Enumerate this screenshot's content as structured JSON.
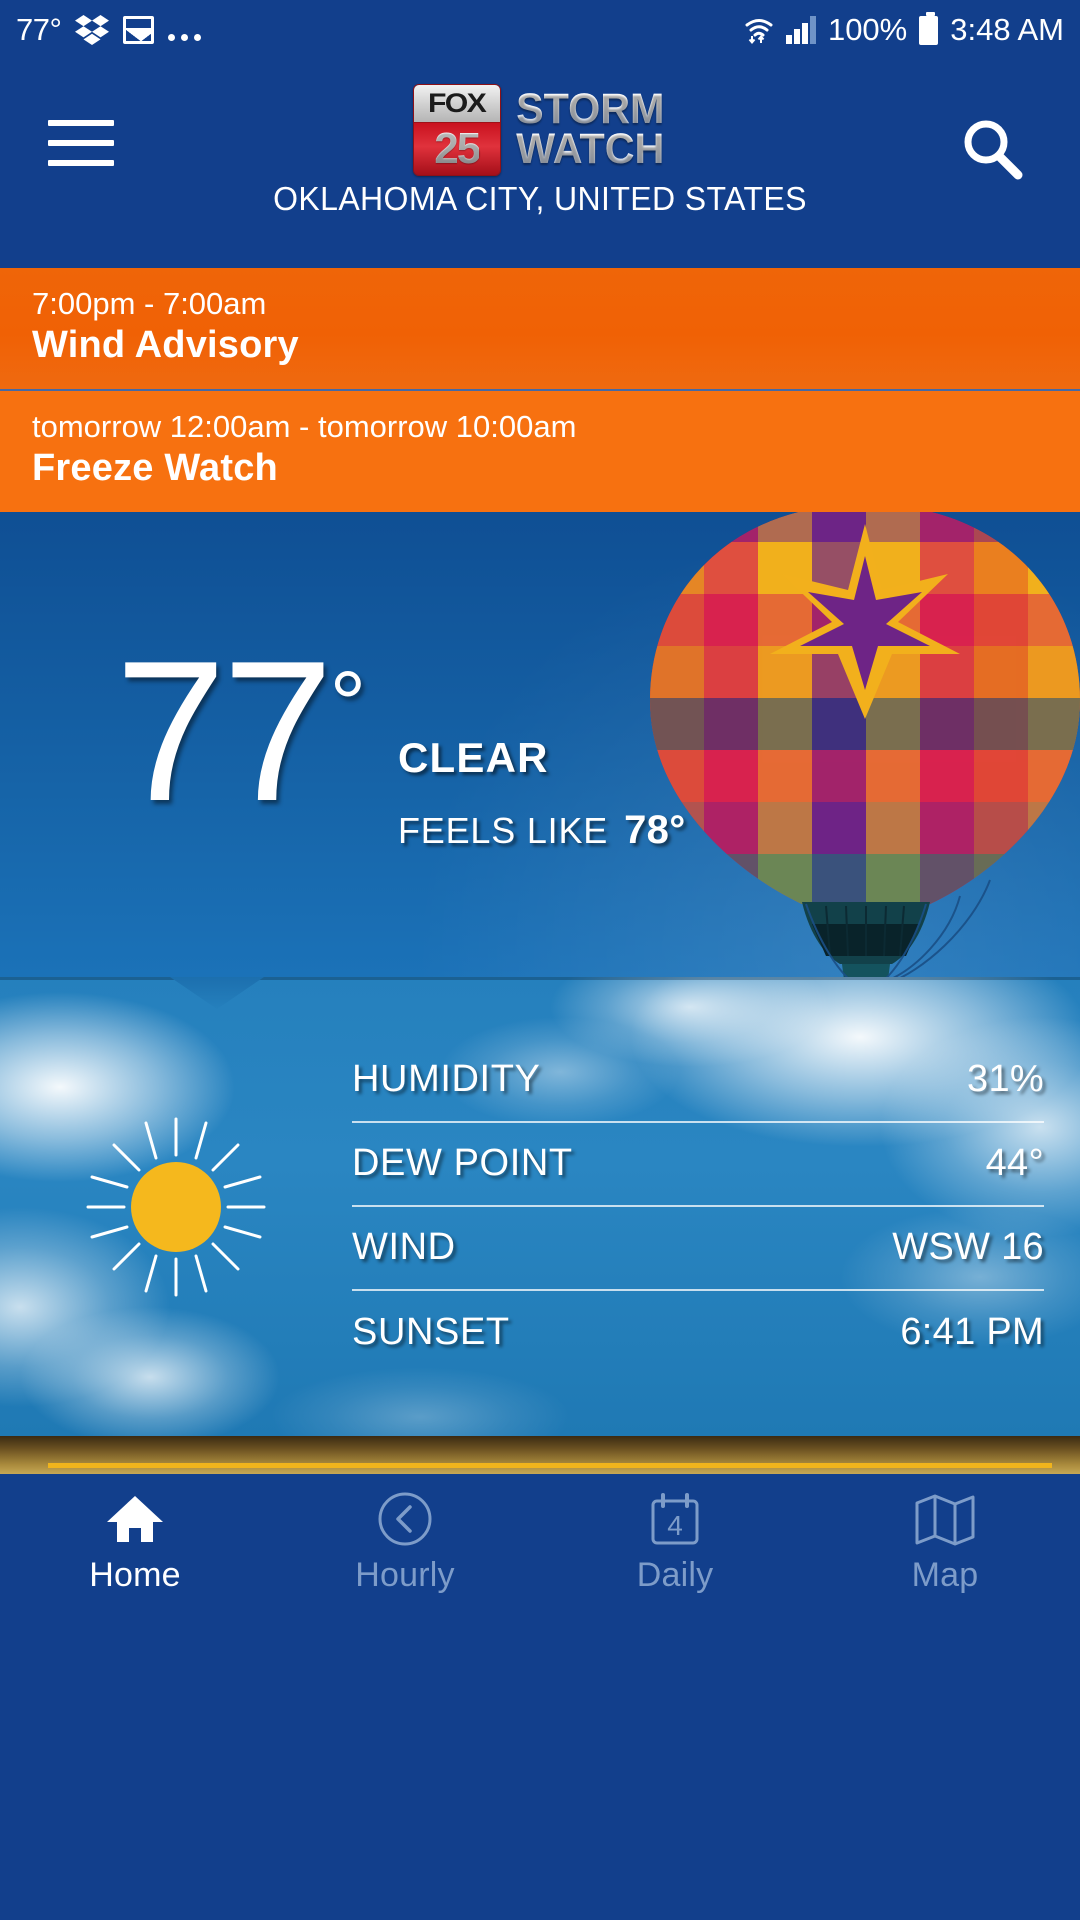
{
  "colors": {
    "brand_blue": "#123F8C",
    "alert_orange": "#F06105",
    "alert_orange_2": "#F77110",
    "sky_blue": "#1B72B8",
    "panel_blue": "#2580BD",
    "sun_gold": "#F5B81D",
    "nav_inactive": "#7D9CC9",
    "accent_yellow": "#F0B41C"
  },
  "statusbar": {
    "temp": "77°",
    "icons": [
      "dropbox-icon",
      "gallery-icon",
      "ellipsis-icon"
    ],
    "wifi_icon": "wifi-icon",
    "signal_icon": "cellular-signal-icon",
    "battery_percent": "100%",
    "battery_icon": "battery-full-icon",
    "clock": "3:48 AM"
  },
  "header": {
    "menu_icon": "hamburger-menu-icon",
    "search_icon": "search-icon",
    "logo": {
      "channel": "FOX",
      "number": "25",
      "line1": "STORM",
      "line2": "WATCH"
    },
    "location": "OKLAHOMA CITY, UNITED STATES"
  },
  "alerts": [
    {
      "when": "7:00pm - 7:00am",
      "what": "Wind Advisory"
    },
    {
      "when": "tomorrow 12:00am - tomorrow 10:00am",
      "what": "Freeze Watch"
    }
  ],
  "current": {
    "temperature": "77",
    "degree": "°",
    "condition": "CLEAR",
    "feels_like_label": "FEELS LIKE",
    "feels_like_value": "78°",
    "icon": "sun-icon"
  },
  "details": [
    {
      "key": "HUMIDITY",
      "value": "31%"
    },
    {
      "key": "DEW POINT",
      "value": "44°"
    },
    {
      "key": "WIND",
      "value": "WSW 16"
    },
    {
      "key": "SUNSET",
      "value": "6:41 PM"
    }
  ],
  "nav": [
    {
      "label": "Home",
      "icon": "home-icon",
      "active": true
    },
    {
      "label": "Hourly",
      "icon": "clock-icon",
      "active": false
    },
    {
      "label": "Daily",
      "icon": "calendar-icon",
      "active": false,
      "badge": "4"
    },
    {
      "label": "Map",
      "icon": "map-icon",
      "active": false
    }
  ]
}
